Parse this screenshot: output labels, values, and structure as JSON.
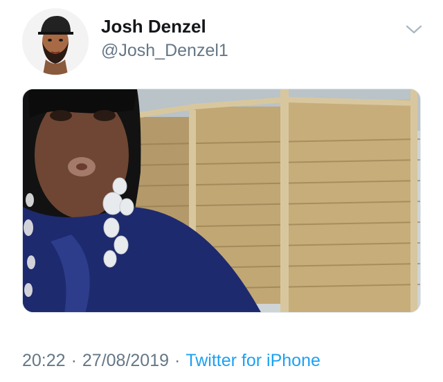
{
  "tweet": {
    "author": {
      "display_name": "Josh Denzel",
      "handle": "@Josh_Denzel1"
    },
    "time": "20:22",
    "separator": "·",
    "date": "27/08/2019",
    "source": "Twitter for iPhone"
  },
  "icons": {
    "menu": "chevron-down-icon",
    "avatar": "cartoon-avatar"
  },
  "colors": {
    "text_primary": "#14171a",
    "text_secondary": "#657786",
    "link": "#1da1f2"
  }
}
